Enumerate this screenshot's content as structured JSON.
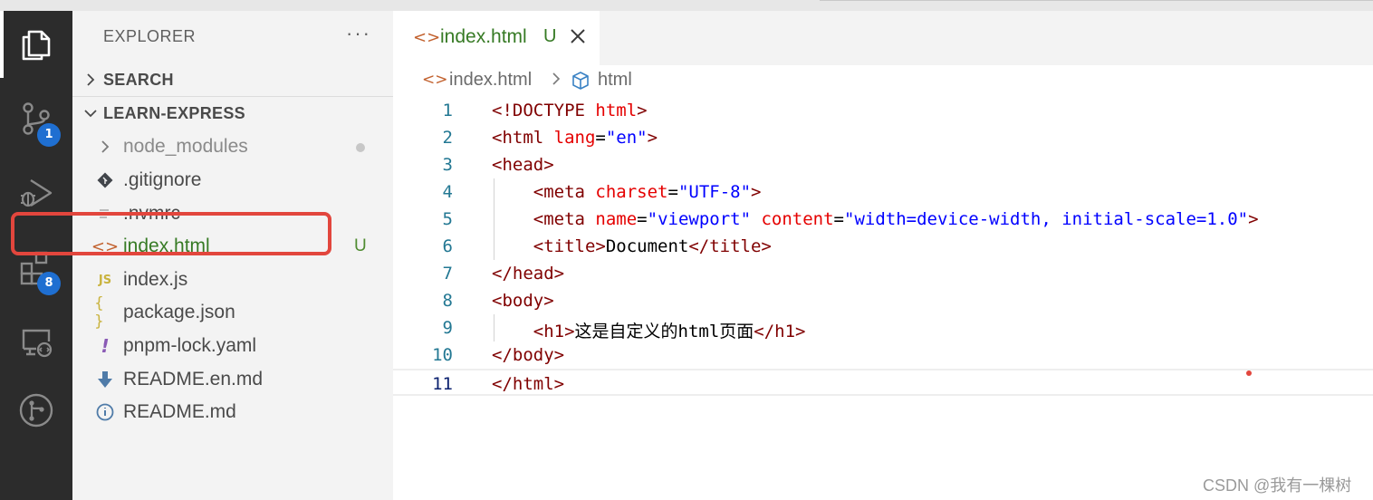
{
  "activity_bar": {
    "items": [
      {
        "name": "explorer",
        "active": true
      },
      {
        "name": "source-control",
        "badge": "1"
      },
      {
        "name": "run-and-debug"
      },
      {
        "name": "extensions",
        "badge": "8"
      },
      {
        "name": "remote-explorer"
      },
      {
        "name": "git-graph"
      }
    ]
  },
  "sidebar": {
    "title": "EXPLORER",
    "more": "···",
    "search_label": "SEARCH",
    "project_label": "LEARN-EXPRESS",
    "files": [
      {
        "name": "node_modules",
        "icon": "chevron-right-icon"
      },
      {
        "name": ".gitignore",
        "icon": "git-icon"
      },
      {
        "name": ".nvmrc",
        "icon": "lines-icon"
      },
      {
        "name": "index.html",
        "icon": "html-icon",
        "status": "U"
      },
      {
        "name": "index.js",
        "icon": "js-icon",
        "glyph": "JS"
      },
      {
        "name": "package.json",
        "icon": "json-icon",
        "glyph": "{ }"
      },
      {
        "name": "pnpm-lock.yaml",
        "icon": "yaml-icon",
        "glyph": "!"
      },
      {
        "name": "README.en.md",
        "icon": "download-arrow-icon"
      },
      {
        "name": "README.md",
        "icon": "info-icon"
      }
    ]
  },
  "tab": {
    "icon": "<>",
    "name": "index.html",
    "status": "U"
  },
  "breadcrumb": {
    "icon": "<>",
    "file": "index.html",
    "symbol": "html"
  },
  "code": {
    "lines": [
      {
        "n": "1",
        "tokens": [
          {
            "t": "tag",
            "v": "<!DOCTYPE "
          },
          {
            "t": "attr",
            "v": "html"
          },
          {
            "t": "tag",
            "v": ">"
          }
        ]
      },
      {
        "n": "2",
        "tokens": [
          {
            "t": "tag",
            "v": "<html "
          },
          {
            "t": "attr",
            "v": "lang"
          },
          {
            "t": "text",
            "v": "="
          },
          {
            "t": "val",
            "v": "\"en\""
          },
          {
            "t": "tag",
            "v": ">"
          }
        ]
      },
      {
        "n": "3",
        "tokens": [
          {
            "t": "tag",
            "v": "<head>"
          }
        ]
      },
      {
        "n": "4",
        "tokens": [
          {
            "t": "text",
            "v": "    "
          },
          {
            "t": "tag",
            "v": "<meta "
          },
          {
            "t": "attr",
            "v": "charset"
          },
          {
            "t": "text",
            "v": "="
          },
          {
            "t": "val",
            "v": "\"UTF-8\""
          },
          {
            "t": "tag",
            "v": ">"
          }
        ]
      },
      {
        "n": "5",
        "tokens": [
          {
            "t": "text",
            "v": "    "
          },
          {
            "t": "tag",
            "v": "<meta "
          },
          {
            "t": "attr",
            "v": "name"
          },
          {
            "t": "text",
            "v": "="
          },
          {
            "t": "val",
            "v": "\"viewport\""
          },
          {
            "t": "text",
            "v": " "
          },
          {
            "t": "attr",
            "v": "content"
          },
          {
            "t": "text",
            "v": "="
          },
          {
            "t": "val",
            "v": "\"width=device-width, initial-scale=1.0\""
          },
          {
            "t": "tag",
            "v": ">"
          }
        ]
      },
      {
        "n": "6",
        "tokens": [
          {
            "t": "text",
            "v": "    "
          },
          {
            "t": "tag",
            "v": "<title>"
          },
          {
            "t": "text",
            "v": "Document"
          },
          {
            "t": "tag",
            "v": "</title>"
          }
        ]
      },
      {
        "n": "7",
        "tokens": [
          {
            "t": "tag",
            "v": "</head>"
          }
        ]
      },
      {
        "n": "8",
        "tokens": [
          {
            "t": "tag",
            "v": "<body>"
          }
        ]
      },
      {
        "n": "9",
        "tokens": [
          {
            "t": "text",
            "v": "    "
          },
          {
            "t": "tag",
            "v": "<h1>"
          },
          {
            "t": "text",
            "v": "这是自定义的html页面"
          },
          {
            "t": "tag",
            "v": "</h1>"
          }
        ]
      },
      {
        "n": "10",
        "tokens": [
          {
            "t": "tag",
            "v": "</body>"
          }
        ]
      },
      {
        "n": "11",
        "tokens": [
          {
            "t": "tag",
            "v": "</html>"
          }
        ]
      }
    ],
    "current_line": "11"
  },
  "watermark": "CSDN @我有一棵树",
  "colors": {
    "tag": "#800000",
    "attr": "#e50000",
    "value": "#0000ff",
    "untracked": "#367a24",
    "annotation": "#e2463d"
  }
}
